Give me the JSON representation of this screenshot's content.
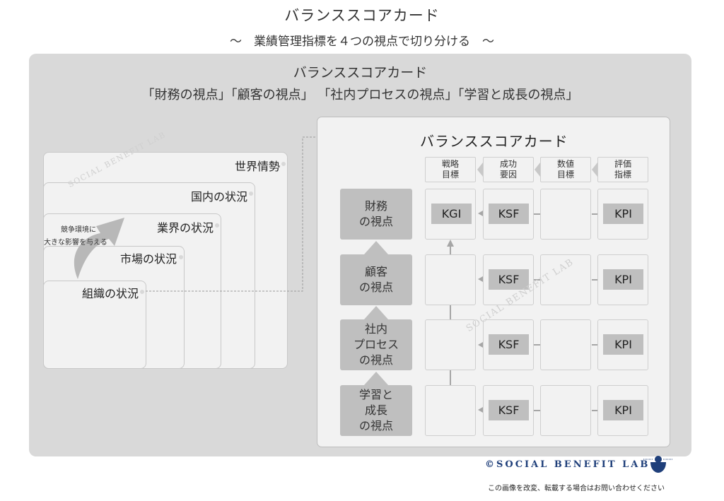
{
  "header": {
    "title": "バランススコアカード",
    "subtitle": "～　業績管理指標を４つの視点で切り分ける　～"
  },
  "panel": {
    "title": "バランススコアカード",
    "subtitle": "「財務の視点」「顧客の視点」 「社内プロセスの視点」「学習と成長の視点」"
  },
  "environment": {
    "levels": [
      {
        "label": "世界情勢"
      },
      {
        "label": "国内の状況"
      },
      {
        "label": "業界の状況"
      },
      {
        "label": "市場の状況"
      },
      {
        "label": "組織の状況"
      }
    ],
    "impact_line1": "競争環境に",
    "impact_line2": "大きな影響を与える",
    "watermark": "SOCIAL BENEFIT LAB"
  },
  "scorecard": {
    "title": "バランススコアカード",
    "columns": [
      {
        "label": "戦略\n目標",
        "line1": "戦略",
        "line2": "目標"
      },
      {
        "label": "成功\n要因",
        "line1": "成功",
        "line2": "要因"
      },
      {
        "label": "数値\n目標",
        "line1": "数値",
        "line2": "目標"
      },
      {
        "label": "評価\n指標",
        "line1": "評価",
        "line2": "指標"
      }
    ],
    "perspectives": [
      {
        "label": "財務\nの視点",
        "goal_tag": "KGI",
        "factor_tag": "KSF",
        "metric_tag": "KPI"
      },
      {
        "label": "顧客\nの視点",
        "goal_tag": "",
        "factor_tag": "KSF",
        "metric_tag": "KPI"
      },
      {
        "label": "社内\nプロセス\nの視点",
        "goal_tag": "",
        "factor_tag": "KSF",
        "metric_tag": "KPI"
      },
      {
        "label": "学習と\n成長\nの視点",
        "goal_tag": "",
        "factor_tag": "KSF",
        "metric_tag": "KPI"
      }
    ],
    "watermark": "SOCIAL BENEFIT LAB"
  },
  "footer": {
    "credit": "©SOCIAL BENEFIT LAB",
    "notice": "この画像を改変、転載する場合はお問い合わせください",
    "brand_color": "#1f3f7a"
  }
}
